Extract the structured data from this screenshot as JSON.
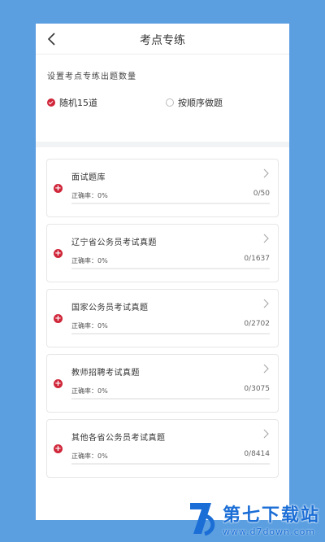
{
  "header": {
    "title": "考点专练"
  },
  "settings": {
    "label": "设置考点专练出题数量",
    "options": [
      {
        "label": "随机15道",
        "selected": true
      },
      {
        "label": "按顺序做题",
        "selected": false
      }
    ]
  },
  "banks": [
    {
      "title": "面试题库",
      "accuracy": "正确率：0%",
      "count": "0/50",
      "progress": 0
    },
    {
      "title": "辽宁省公务员考试真题",
      "accuracy": "正确率：0%",
      "count": "0/1637",
      "progress": 0
    },
    {
      "title": "国家公务员考试真题",
      "accuracy": "正确率：0%",
      "count": "0/2702",
      "progress": 0
    },
    {
      "title": "教师招聘考试真题",
      "accuracy": "正确率：0%",
      "count": "0/3075",
      "progress": 0
    },
    {
      "title": "其他各省公务员考试真题",
      "accuracy": "正确率：0%",
      "count": "0/8414",
      "progress": 0
    }
  ],
  "watermark": {
    "name": "第七下载站",
    "url": "www.d7down.com"
  },
  "colors": {
    "accent": "#d0263a",
    "background": "#5b9fe0",
    "watermark": "#1b6ed6"
  }
}
